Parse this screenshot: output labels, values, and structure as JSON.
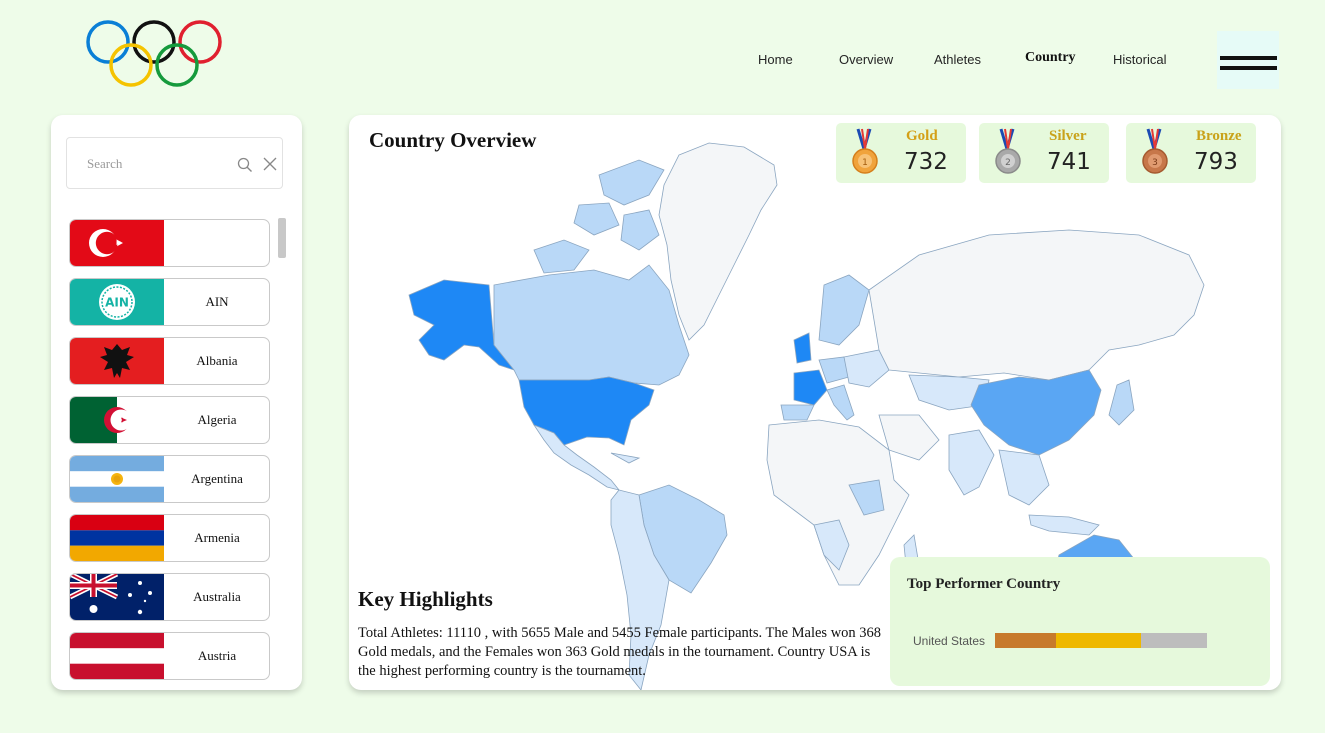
{
  "nav": {
    "items": [
      {
        "label": "Home",
        "active": false
      },
      {
        "label": "Overview",
        "active": false
      },
      {
        "label": "Athletes",
        "active": false
      },
      {
        "label": "Country",
        "active": true
      },
      {
        "label": "Historical",
        "active": false
      }
    ]
  },
  "sidebar": {
    "search_placeholder": "Search",
    "countries": [
      {
        "name": "",
        "flag": "turkey"
      },
      {
        "name": "AIN",
        "flag": "ain"
      },
      {
        "name": "Albania",
        "flag": "albania"
      },
      {
        "name": "Algeria",
        "flag": "algeria"
      },
      {
        "name": "Argentina",
        "flag": "argentina"
      },
      {
        "name": "Armenia",
        "flag": "armenia"
      },
      {
        "name": "Australia",
        "flag": "australia"
      },
      {
        "name": "Austria",
        "flag": "austria"
      }
    ],
    "flag_text": {
      "ain": "AIN"
    }
  },
  "main": {
    "title": "Country Overview",
    "medals": [
      {
        "label": "Gold",
        "count": "732",
        "color": "#d4a017"
      },
      {
        "label": "Silver",
        "count": "741",
        "color": "#c9a21a"
      },
      {
        "label": "Bronze",
        "count": "793",
        "color": "#c9a21a"
      }
    ],
    "key_highlights": {
      "title": "Key Highlights",
      "text": "Total Athletes: 11110 , with 5655 Male and 5455 Female participants. The Males won 368 Gold medals, and the Females won 363 Gold medals in the tournament. Country USA is the highest performing country is the tournament."
    },
    "top_performer": {
      "title": "Top Performer Country",
      "country": "United States",
      "segments": [
        {
          "name": "bronze",
          "fraction": 0.29,
          "color": "#c77a2c"
        },
        {
          "name": "gold",
          "fraction": 0.4,
          "color": "#eeb800"
        },
        {
          "name": "silver",
          "fraction": 0.31,
          "color": "#bdbdbd"
        }
      ]
    },
    "map_colors": {
      "usa": "#1e88f5",
      "china": "#5aa6f3",
      "light": "#b9d8f7",
      "lighter": "#d7e8fa",
      "none": "#f4f6f8"
    }
  }
}
